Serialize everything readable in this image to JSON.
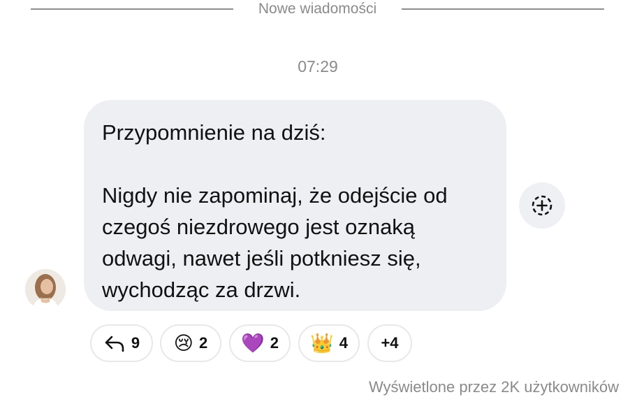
{
  "divider": {
    "label": "Nowe wiadomości"
  },
  "message": {
    "time": "07:29",
    "heading": "Przypomnienie na dziś:",
    "body_lines": [
      "Nigdy nie zapominaj, że odejście od",
      "czegoś niezdrowego jest oznaką",
      "odwagi, nawet jeśli potkniesz się,",
      "wychodząc za drzwi."
    ]
  },
  "reactions": [
    {
      "icon": "reply-arrow-icon",
      "count": "9"
    },
    {
      "icon": "crying-face-icon",
      "glyph": "😢",
      "count": "2"
    },
    {
      "icon": "purple-heart-icon",
      "glyph": "💜",
      "count": "2"
    },
    {
      "icon": "crown-icon",
      "glyph": "👑",
      "count": "4"
    },
    {
      "more": "+4"
    }
  ],
  "footer": {
    "seen_text": "Wyświetlone przez 2K użytkowników"
  },
  "colors": {
    "bubble": "#eeeff2",
    "muted_text": "#8a8a8a",
    "pill_border": "#e8e8e8"
  }
}
